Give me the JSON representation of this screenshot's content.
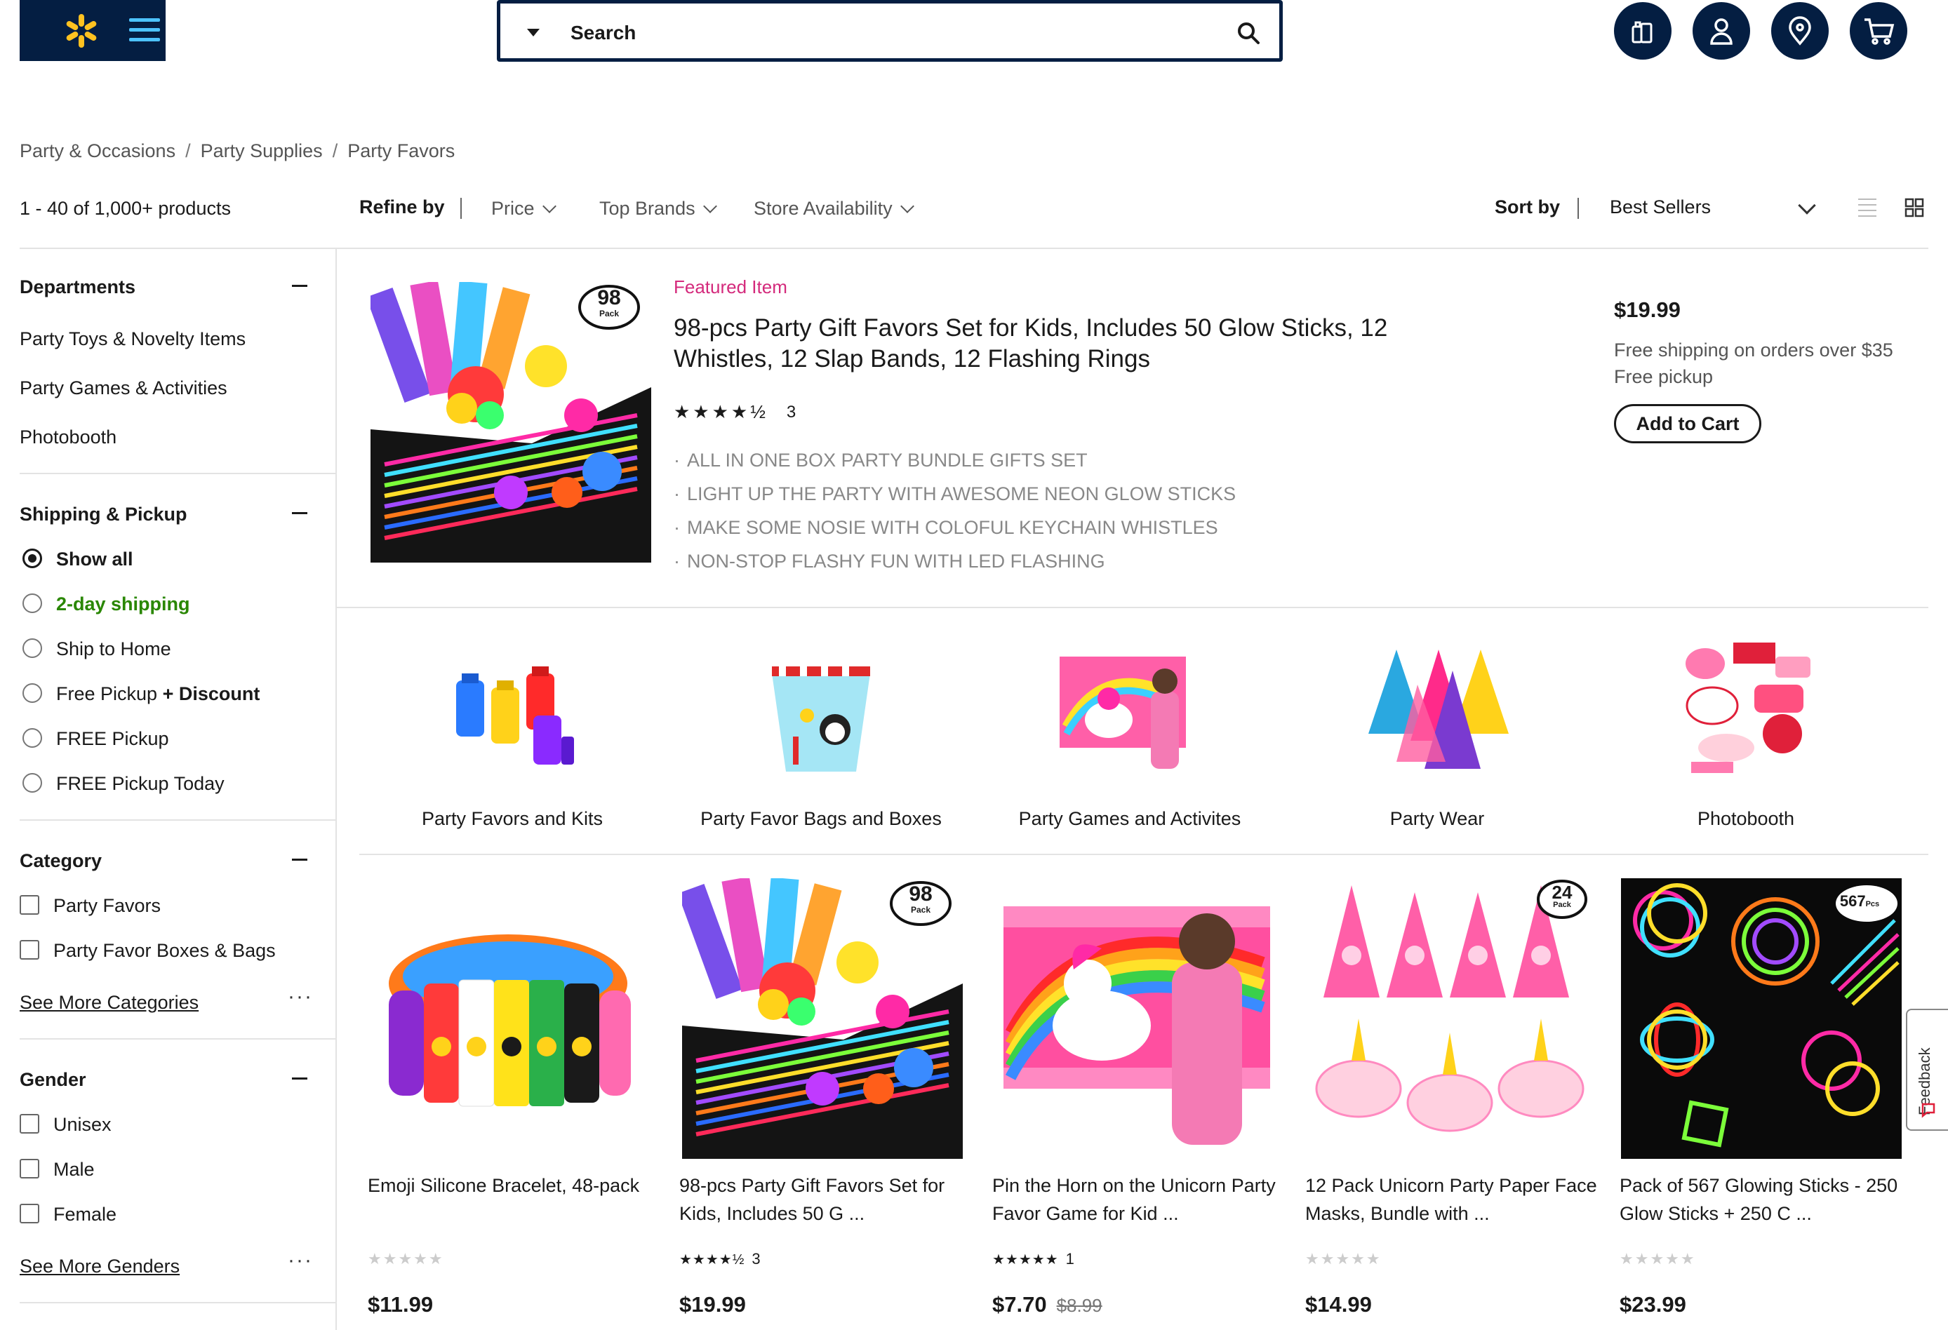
{
  "header": {
    "search_placeholder": "Search",
    "icons": [
      "walmart-spark-icon",
      "menu-icon",
      "search-icon",
      "reorder-icon",
      "account-icon",
      "store-location-icon",
      "cart-icon"
    ]
  },
  "breadcrumb": [
    "Party & Occasions",
    "Party Supplies",
    "Party Favors"
  ],
  "toolbar": {
    "count": "1 - 40 of 1,000+ products",
    "refine_label": "Refine by",
    "filters": [
      "Price",
      "Top Brands",
      "Store Availability"
    ],
    "sort_label": "Sort by",
    "sort_value": "Best Sellers"
  },
  "sidebar": {
    "departments": {
      "title": "Departments",
      "items": [
        "Party Toys & Novelty Items",
        "Party Games & Activities",
        "Photobooth"
      ]
    },
    "shipping": {
      "title": "Shipping & Pickup",
      "options": [
        "Show all",
        "2-day shipping",
        "Ship to Home",
        "Free Pickup",
        "+ Discount",
        "FREE Pickup",
        "FREE Pickup Today"
      ]
    },
    "category": {
      "title": "Category",
      "items": [
        "Party Favors",
        "Party Favor Boxes & Bags"
      ],
      "see_more": "See More Categories"
    },
    "gender": {
      "title": "Gender",
      "items": [
        "Unisex",
        "Male",
        "Female"
      ],
      "see_more": "See More Genders"
    }
  },
  "featured": {
    "label": "Featured Item",
    "title": "98-pcs Party Gift Favors Set for Kids, Includes 50 Glow Sticks, 12 Whistles, 12 Slap Bands, 12 Flashing Rings",
    "stars": "★★★★½",
    "reviews": "3",
    "bullets": [
      "ALL IN ONE BOX PARTY BUNDLE GIFTS SET",
      "LIGHT UP THE PARTY WITH AWESOME NEON GLOW STICKS",
      "MAKE SOME NOSIE WITH COLOFUL KEYCHAIN WHISTLES",
      "NON-STOP FLASHY FUN WITH LED FLASHING"
    ],
    "price": "$19.99",
    "shipping": "Free shipping on orders over $35",
    "pickup": "Free pickup",
    "add_to_cart": "Add to Cart",
    "badge": "98",
    "badge_sub": "Pack"
  },
  "categories": [
    "Party Favors and Kits",
    "Party Favor Bags and Boxes",
    "Party Games and Activites",
    "Party Wear",
    "Photobooth"
  ],
  "products": [
    {
      "title_line1": "Emoji Silicone Bracelet, 48-pack",
      "title_line2": "",
      "stars": "★★★★★",
      "reviews": "",
      "rated": false,
      "price": "$11.99",
      "was": ""
    },
    {
      "title_line1": "98-pcs Party Gift Favors Set for",
      "title_line2": "Kids, Includes 50 G ...",
      "stars": "★★★★½",
      "reviews": "3",
      "rated": true,
      "price": "$19.99",
      "was": ""
    },
    {
      "title_line1": "Pin the Horn on the Unicorn Party",
      "title_line2": "Favor Game for Kid ...",
      "stars": "★★★★★",
      "reviews": "1",
      "rated": true,
      "price": "$7.70",
      "was": "$8.99"
    },
    {
      "title_line1": "12 Pack Unicorn Party Paper Face",
      "title_line2": "Masks, Bundle with ...",
      "stars": "★★★★★",
      "reviews": "",
      "rated": false,
      "price": "$14.99",
      "was": ""
    },
    {
      "title_line1": "Pack of 567 Glowing Sticks - 250",
      "title_line2": "Glow Sticks + 250 C ...",
      "stars": "★★★★★",
      "reviews": "",
      "rated": false,
      "price": "$23.99",
      "was": ""
    }
  ],
  "product_badges": {
    "p2": "98",
    "p2_sub": "Pack",
    "p4": "24",
    "p4_sub": "Pack",
    "p5": "567",
    "p5_sub": "Pcs"
  },
  "feedback": "Feedback",
  "colors": {
    "navy": "#041e42",
    "spark": "#ffc220",
    "featured": "#d42a7c",
    "green": "#2a8703"
  }
}
